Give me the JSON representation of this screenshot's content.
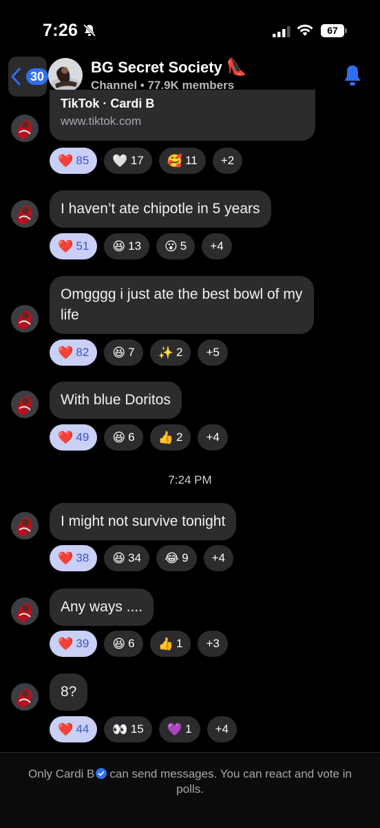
{
  "status_bar": {
    "time": "7:26",
    "battery": "67"
  },
  "header": {
    "back_count": "30",
    "channel_name": "BG Secret Society",
    "channel_emoji": "👠",
    "subtitle": "Channel • 77.9K members"
  },
  "link_preview": {
    "title": "TikTok · Cardi B",
    "url": "www.tiktok.com"
  },
  "messages": [
    {
      "text": "I haven’t ate chipotle in 5 years"
    },
    {
      "text": "Omgggg i just ate the best bowl of my life"
    },
    {
      "text": "With blue Doritos"
    },
    {
      "text": "I might not survive tonight"
    },
    {
      "text": "Any ways ...."
    },
    {
      "text": "8?"
    }
  ],
  "reactions": [
    {
      "items": [
        {
          "emoji": "❤️",
          "count": "85"
        },
        {
          "emoji": "🤍",
          "count": "17"
        },
        {
          "emoji": "🥰",
          "count": "11"
        },
        {
          "emoji": "",
          "count": "+2"
        }
      ]
    },
    {
      "items": [
        {
          "emoji": "❤️",
          "count": "51"
        },
        {
          "emoji": "😆",
          "count": "13"
        },
        {
          "emoji": "😮",
          "count": "5"
        },
        {
          "emoji": "",
          "count": "+4"
        }
      ]
    },
    {
      "items": [
        {
          "emoji": "❤️",
          "count": "82"
        },
        {
          "emoji": "😆",
          "count": "7"
        },
        {
          "emoji": "✨",
          "count": "2"
        },
        {
          "emoji": "",
          "count": "+5"
        }
      ]
    },
    {
      "items": [
        {
          "emoji": "❤️",
          "count": "49"
        },
        {
          "emoji": "😆",
          "count": "6"
        },
        {
          "emoji": "👍",
          "count": "2"
        },
        {
          "emoji": "",
          "count": "+4"
        }
      ]
    },
    {
      "items": [
        {
          "emoji": "❤️",
          "count": "38"
        },
        {
          "emoji": "😆",
          "count": "34"
        },
        {
          "emoji": "😂",
          "count": "9"
        },
        {
          "emoji": "",
          "count": "+4"
        }
      ]
    },
    {
      "items": [
        {
          "emoji": "❤️",
          "count": "39"
        },
        {
          "emoji": "😆",
          "count": "6"
        },
        {
          "emoji": "👍",
          "count": "1"
        },
        {
          "emoji": "",
          "count": "+3"
        }
      ]
    },
    {
      "items": [
        {
          "emoji": "❤️",
          "count": "44"
        },
        {
          "emoji": "👀",
          "count": "15"
        },
        {
          "emoji": "💜",
          "count": "1"
        },
        {
          "emoji": "",
          "count": "+4"
        }
      ]
    }
  ],
  "timestamp": "7:24 PM",
  "footer": {
    "before": "Only Cardi B",
    "after": "can send messages. You can react and vote in polls."
  },
  "colors": {
    "accent": "#2f6ff5",
    "bubble": "#2c2c2e",
    "my_reaction_bg": "#c9cff5",
    "my_reaction_text": "#3a55c9"
  }
}
